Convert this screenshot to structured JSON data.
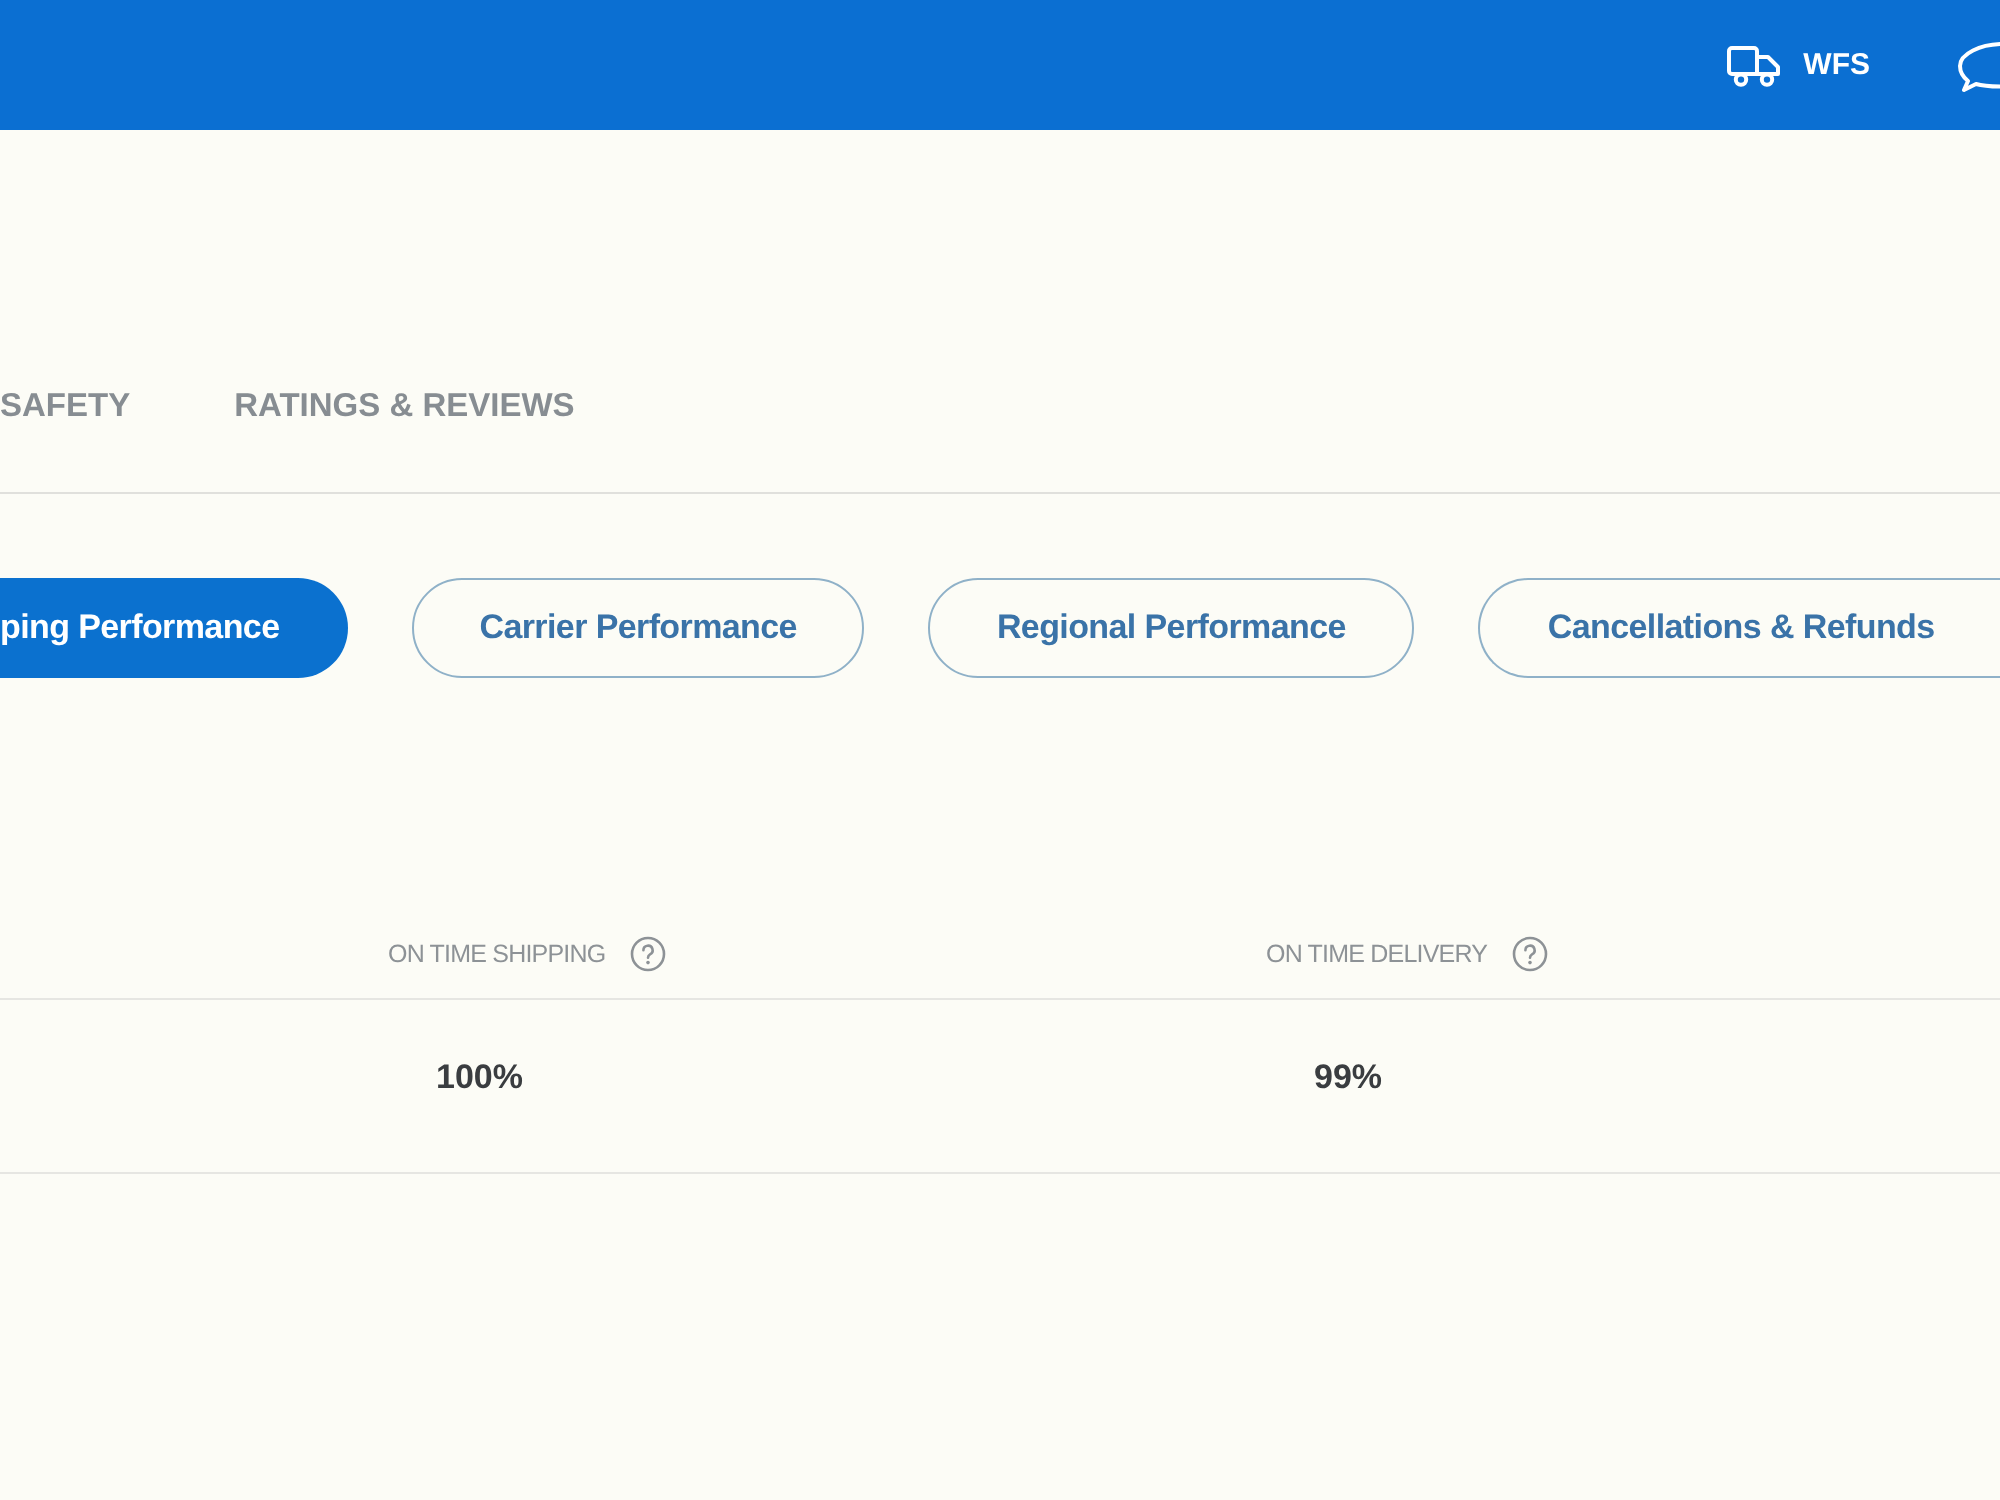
{
  "header": {
    "wfs_label": "WFS"
  },
  "tabs": [
    {
      "label": "SAFETY",
      "selected": false
    },
    {
      "label": "RATINGS & REVIEWS",
      "selected": false
    }
  ],
  "filters": [
    {
      "label": "ping Performance",
      "selected": true
    },
    {
      "label": "Carrier Performance",
      "selected": false
    },
    {
      "label": "Regional Performance",
      "selected": false
    },
    {
      "label": "Cancellations & Refunds",
      "selected": false
    }
  ],
  "table": {
    "columns": [
      {
        "label": "ON TIME SHIPPING"
      },
      {
        "label": "ON TIME DELIVERY"
      }
    ],
    "rows": [
      [
        "100%",
        "99%"
      ]
    ]
  }
}
